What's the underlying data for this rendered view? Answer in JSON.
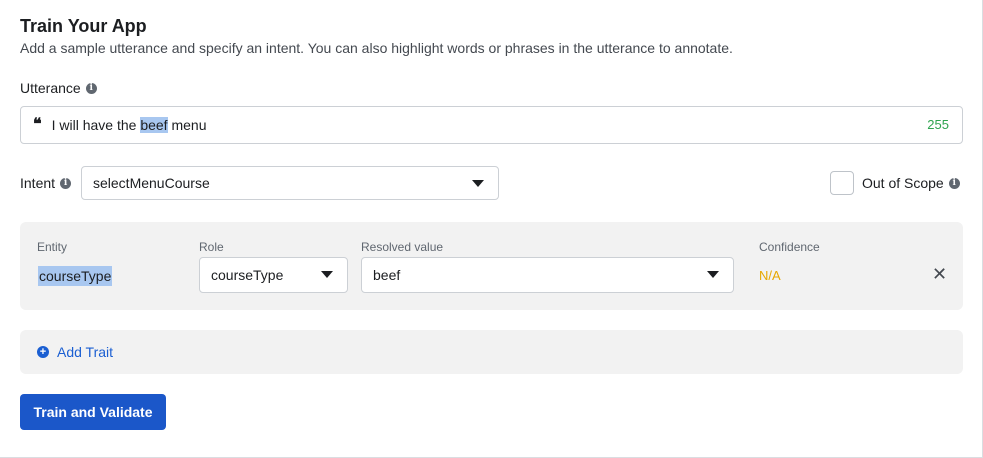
{
  "header": {
    "title": "Train Your App",
    "subtitle": "Add a sample utterance and specify an intent. You can also highlight words or phrases in the utterance to annotate."
  },
  "utterance": {
    "label": "Utterance",
    "before": "I will have the ",
    "highlight": "beef",
    "after": " menu",
    "remaining_chars": "255"
  },
  "intent": {
    "label": "Intent",
    "selected": "selectMenuCourse"
  },
  "out_of_scope": {
    "label": "Out of Scope",
    "checked": false
  },
  "entity_row": {
    "headers": {
      "entity": "Entity",
      "role": "Role",
      "resolved": "Resolved value",
      "confidence": "Confidence"
    },
    "entity": "courseType",
    "role": "courseType",
    "resolved_value": "beef",
    "confidence": "N/A"
  },
  "add_trait_label": "Add Trait",
  "train_button_label": "Train and Validate",
  "icons": {
    "info": "info-icon",
    "quote": "quote-icon",
    "caret": "chevron-down-icon",
    "close": "close-icon",
    "add": "plus-circle-icon"
  },
  "colors": {
    "primary": "#1b57c9",
    "link": "#1b5fd2",
    "highlight": "#a8c7f0",
    "counter": "#2ea44f",
    "confidence": "#e7a700"
  }
}
